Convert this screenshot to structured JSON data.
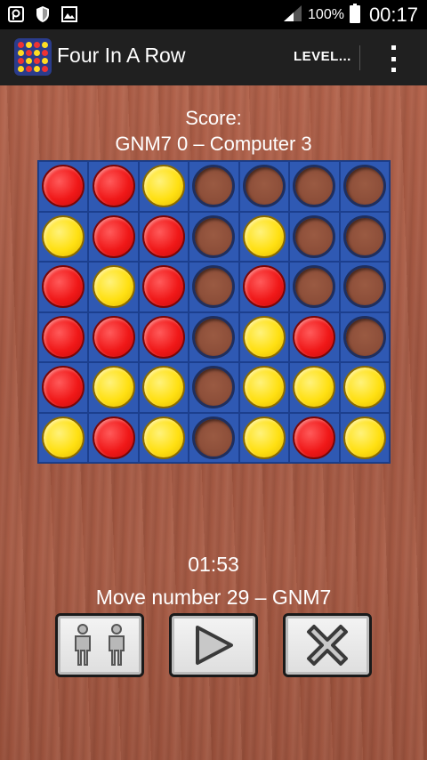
{
  "status_bar": {
    "battery_percent": "100%",
    "time": "00:17",
    "icons": [
      "pocket-icon",
      "shield-icon",
      "image-icon",
      "signal-icon",
      "battery-icon"
    ]
  },
  "action_bar": {
    "title": "Four In A Row",
    "level_label": "LEVEL...",
    "overflow_icon": "more-vert-icon"
  },
  "score": {
    "label": "Score:",
    "line": "GNM7 0 – Computer 3"
  },
  "board": {
    "rows": 6,
    "cols": 7,
    "cells": [
      [
        "red",
        "red",
        "yellow",
        "empty",
        "empty",
        "empty",
        "empty"
      ],
      [
        "yellow",
        "red",
        "red",
        "empty",
        "yellow",
        "empty",
        "empty"
      ],
      [
        "red",
        "yellow",
        "red",
        "empty",
        "red",
        "empty",
        "empty"
      ],
      [
        "red",
        "red",
        "red",
        "empty",
        "yellow",
        "red",
        "empty"
      ],
      [
        "red",
        "yellow",
        "yellow",
        "empty",
        "yellow",
        "yellow",
        "yellow"
      ],
      [
        "yellow",
        "red",
        "yellow",
        "empty",
        "yellow",
        "red",
        "yellow"
      ]
    ],
    "colors": {
      "board": "#2f59b3",
      "red": "#f01818",
      "yellow": "#ffe012"
    }
  },
  "timer": "01:53",
  "move_line": "Move number 29 – GNM7",
  "controls": [
    {
      "name": "two-players-button",
      "icon": "two-players-icon"
    },
    {
      "name": "play-button",
      "icon": "play-icon"
    },
    {
      "name": "close-button",
      "icon": "close-icon"
    }
  ]
}
